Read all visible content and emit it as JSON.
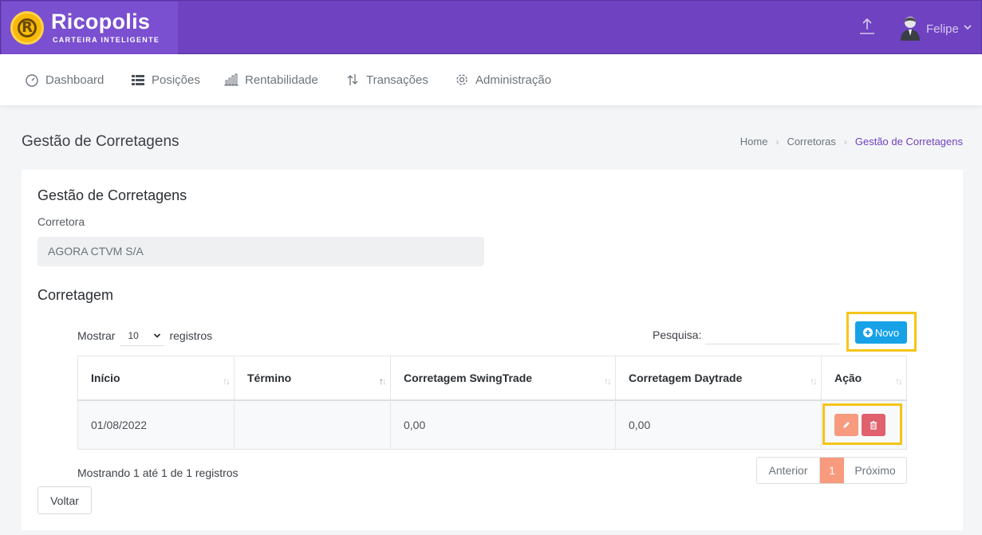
{
  "brand": {
    "name": "Ricopolis",
    "tagline": "CARTEIRA INTELIGENTE",
    "logo_letter": "R",
    "accent": "#6f42c1"
  },
  "header": {
    "user_name": "Felipe"
  },
  "nav": [
    {
      "label": "Dashboard",
      "icon": "gauge-icon"
    },
    {
      "label": "Posições",
      "icon": "list-icon"
    },
    {
      "label": "Rentabilidade",
      "icon": "bar-chart-icon"
    },
    {
      "label": "Transações",
      "icon": "arrows-updown-icon"
    },
    {
      "label": "Administração",
      "icon": "gear-icon"
    }
  ],
  "page": {
    "title": "Gestão de Corretagens",
    "breadcrumb": [
      "Home",
      "Corretoras",
      "Gestão de Corretagens"
    ]
  },
  "card": {
    "title": "Gestão de Corretagens",
    "corretora_label": "Corretora",
    "corretora_value": "AGORA CTVM S/A",
    "section_title": "Corretagem"
  },
  "table_controls": {
    "show_label": "Mostrar",
    "page_length": "10",
    "records_label": "registros",
    "search_label": "Pesquisa:",
    "new_button": "Novo"
  },
  "table": {
    "columns": [
      "Início",
      "Término",
      "Corretagem SwingTrade",
      "Corretagem Daytrade",
      "Ação"
    ],
    "rows": [
      {
        "inicio": "01/08/2022",
        "termino": "",
        "swing": "0,00",
        "day": "0,00"
      }
    ]
  },
  "pagination": {
    "info": "Mostrando 1 até 1 de 1 registros",
    "prev": "Anterior",
    "current": "1",
    "next": "Próximo"
  },
  "back_button": "Voltar",
  "colors": {
    "highlight": "#f5c518",
    "primary_button": "#17a2e8",
    "edit": "#f79a7e",
    "delete": "#e0606e"
  }
}
